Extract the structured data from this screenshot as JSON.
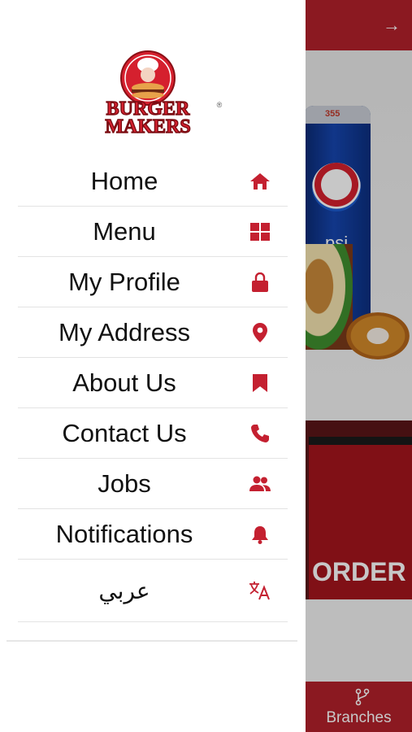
{
  "colors": {
    "accent": "#b3212b",
    "icon": "#c42030",
    "text": "#111111",
    "divider": "#e3e3e3"
  },
  "brand": {
    "line1": "BURGER",
    "line2": "MAKERS",
    "reg": "®"
  },
  "menu": [
    {
      "label": "Home",
      "icon": "home-icon"
    },
    {
      "label": "Menu",
      "icon": "grid-icon"
    },
    {
      "label": "My Profile",
      "icon": "lock-icon"
    },
    {
      "label": "My Address",
      "icon": "location-pin-icon"
    },
    {
      "label": "About Us",
      "icon": "bookmark-icon"
    },
    {
      "label": "Contact Us",
      "icon": "phone-icon"
    },
    {
      "label": "Jobs",
      "icon": "people-icon"
    },
    {
      "label": "Notifications",
      "icon": "bell-icon"
    },
    {
      "label": "عربي",
      "icon": "translate-icon"
    }
  ],
  "background": {
    "header_arrow": "→",
    "can_size": "355",
    "can_text": "psi",
    "banner_text": "ORDER",
    "bottom_tab": "Branches"
  }
}
